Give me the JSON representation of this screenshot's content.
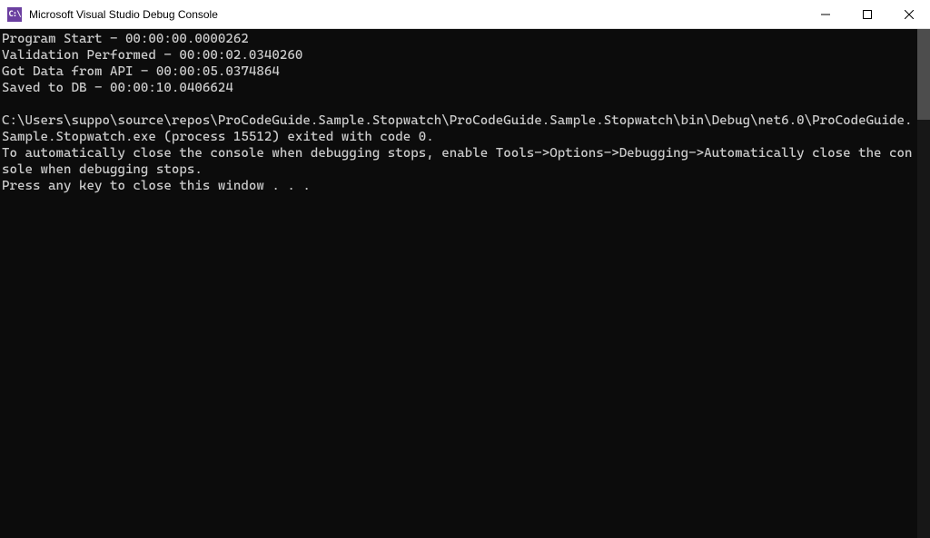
{
  "window": {
    "title": "Microsoft Visual Studio Debug Console",
    "icon_label": "C:\\"
  },
  "console": {
    "lines": [
      "Program Start - 00:00:00.0000262",
      "Validation Performed - 00:00:02.0340260",
      "Got Data from API - 00:00:05.0374864",
      "Saved to DB - 00:00:10.0406624",
      "",
      "C:\\Users\\suppo\\source\\repos\\ProCodeGuide.Sample.Stopwatch\\ProCodeGuide.Sample.Stopwatch\\bin\\Debug\\net6.0\\ProCodeGuide.Sample.Stopwatch.exe (process 15512) exited with code 0.",
      "To automatically close the console when debugging stops, enable Tools->Options->Debugging->Automatically close the console when debugging stops.",
      "Press any key to close this window . . ."
    ]
  }
}
